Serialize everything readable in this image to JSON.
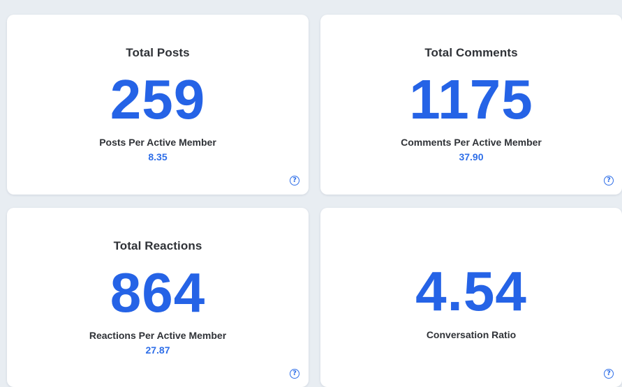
{
  "colors": {
    "background": "#e8edf2",
    "card": "#ffffff",
    "accent": "#2563e6",
    "text": "#2f3237"
  },
  "cards": [
    {
      "title": "Total Posts",
      "value": "259",
      "sublabel": "Posts Per Active Member",
      "subvalue": "8.35",
      "help_icon": "question-circle-icon",
      "help_glyph": "?"
    },
    {
      "title": "Total Comments",
      "value": "1175",
      "sublabel": "Comments Per Active Member",
      "subvalue": "37.90",
      "help_icon": "question-circle-icon",
      "help_glyph": "?"
    },
    {
      "title": "Total Reactions",
      "value": "864",
      "sublabel": "Reactions Per Active Member",
      "subvalue": "27.87",
      "help_icon": "question-circle-icon",
      "help_glyph": "?"
    },
    {
      "title": "",
      "value": "4.54",
      "sublabel": "Conversation Ratio",
      "subvalue": "",
      "help_icon": "question-circle-icon",
      "help_glyph": "?"
    }
  ]
}
